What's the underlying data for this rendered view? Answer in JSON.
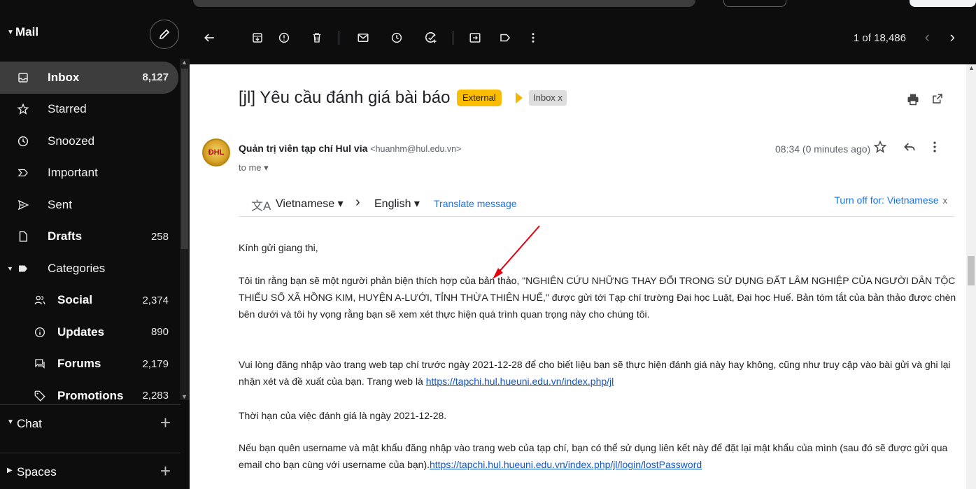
{
  "sidebar": {
    "title": "Mail",
    "items": [
      {
        "label": "Inbox",
        "count": "8,127"
      },
      {
        "label": "Starred",
        "count": ""
      },
      {
        "label": "Snoozed",
        "count": ""
      },
      {
        "label": "Important",
        "count": ""
      },
      {
        "label": "Sent",
        "count": ""
      },
      {
        "label": "Drafts",
        "count": "258"
      },
      {
        "label": "Categories",
        "count": ""
      },
      {
        "label": "Social",
        "count": "2,374"
      },
      {
        "label": "Updates",
        "count": "890"
      },
      {
        "label": "Forums",
        "count": "2,179"
      },
      {
        "label": "Promotions",
        "count": "2,283"
      }
    ],
    "chat_label": "Chat",
    "spaces_label": "Spaces"
  },
  "toolbar": {
    "pager": "1 of 18,486",
    "prev": "‹",
    "next": "›"
  },
  "message": {
    "subject": "[jl] Yêu cầu đánh giá bài báo",
    "external_badge": "External",
    "inbox_chip": "Inbox x",
    "sender_name": "Quản trị viên tạp chí Hul via",
    "sender_email": "<huanhm@hul.edu.vn>",
    "to_me": "to me ▾",
    "timestamp": "08:34 (0 minutes ago)",
    "avatar_text": "ĐHL"
  },
  "translate": {
    "source": "Vietnamese ▾",
    "target": "English ▾",
    "link": "Translate message",
    "turn_off": "Turn off for: Vietnamese",
    "close": "x"
  },
  "body": {
    "greeting": "Kính gửi giang thi,",
    "para1": "Tôi tin rằng bạn sẽ một người phản biện thích hợp của bản thảo, \"NGHIÊN CỨU NHỮNG THAY ĐỔI TRONG SỬ DỤNG ĐẤT LÂM NGHIỆP CỦA NGƯỜI DÂN TỘC THIỂU SỐ XÃ HỒNG KIM, HUYỆN A-LƯỚI, TỈNH THỪA THIÊN HUẾ,\" được gửi tới Tạp chí trường Đại học Luật, Đại học Huế. Bản tóm tắt của bản thảo được chèn bên dưới và tôi hy vọng rằng bạn sẽ xem xét thực hiện quá trình quan trọng này cho chúng tôi.",
    "para2_text": "Vui lòng đăng nhập vào trang web tạp chí trước ngày 2021-12-28 để cho biết liệu bạn sẽ thực hiện đánh giá này hay không, cũng như truy cập vào bài gửi và ghi lại nhận xét và đề xuất của bạn. Trang web là ",
    "para2_link": "https://tapchi.hul.hueuni.edu.vn/index.php/jl",
    "para3": "Thời hạn của việc đánh giá là ngày 2021-12-28.",
    "para4_text": "Nếu bạn quên username và mật khẩu đăng nhập vào trang web của tạp chí, bạn có thể sử dụng liên kết này để đặt lại mật khẩu của mình (sau đó sẽ được gửi qua email cho bạn cùng với username của bạn).",
    "para4_link": "https://tapchi.hul.hueuni.edu.vn/index.php/jl/login/lostPassword"
  },
  "colors": {
    "sidebar_bg": "#0d0d0d",
    "active_item": "#3d3d3d",
    "external_badge": "#fbbc04",
    "link": "#1155cc",
    "annotation_arrow": "#e3000f"
  }
}
